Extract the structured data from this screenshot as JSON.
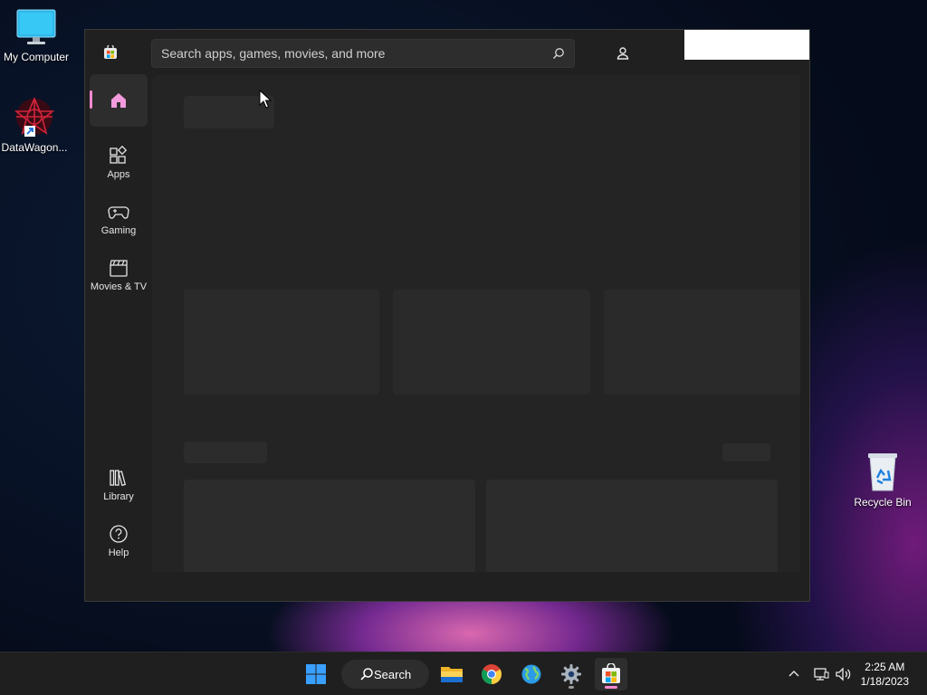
{
  "desktop": {
    "icons": [
      {
        "label": "My Computer"
      },
      {
        "label": "DataWagon..."
      },
      {
        "label": "Recycle Bin"
      }
    ]
  },
  "store": {
    "search_placeholder": "Search apps, games, movies, and more",
    "nav": [
      {
        "label": "Home",
        "icon": "home-icon"
      },
      {
        "label": "Apps",
        "icon": "apps-icon"
      },
      {
        "label": "Gaming",
        "icon": "gamepad-icon"
      },
      {
        "label": "Movies & TV",
        "icon": "clapperboard-icon"
      },
      {
        "label": "Library",
        "icon": "library-icon"
      },
      {
        "label": "Help",
        "icon": "help-icon"
      }
    ]
  },
  "taskbar": {
    "search_label": "Search",
    "time": "2:25 AM",
    "date": "1/18/2023"
  },
  "colors": {
    "accent": "#ff8ad0",
    "window_bg": "#202020",
    "taskbar_bg": "#1f1f1f"
  }
}
